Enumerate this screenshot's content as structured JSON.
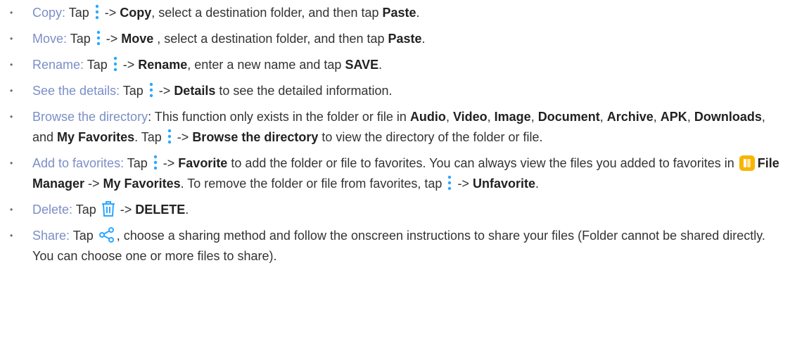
{
  "colors": {
    "label": "#7b8fc7",
    "icon": "#2aa7ff",
    "app_icon": "#f7b500"
  },
  "icons": {
    "menu": "vertical-dots-icon",
    "delete": "trash-icon",
    "share": "share-icon",
    "app": "file-manager-app-icon"
  },
  "items": [
    {
      "label": "Copy:",
      "t1": " Tap ",
      "t2": " -> ",
      "b1": "Copy",
      "t3": ", select a destination folder, and then tap ",
      "b2": "Paste",
      "t4": "."
    },
    {
      "label": "Move:",
      "t1": " Tap ",
      "t2": " -> ",
      "b1": "Move",
      "t3": " , select a destination folder, and then tap ",
      "b2": "Paste",
      "t4": "."
    },
    {
      "label": "Rename:",
      "t1": " Tap ",
      "t2": " -> ",
      "b1": "Rename",
      "t3": ", enter a new name and tap ",
      "b2": "SAVE",
      "t4": "."
    },
    {
      "label": "See the details:",
      "t1": " Tap ",
      "t2": " -> ",
      "b1": "Details",
      "t3": " to see the detailed information."
    },
    {
      "label": "Browse the directory",
      "t1": ": This function only exists in the folder or file in ",
      "b1": "Audio",
      "s1": ", ",
      "b2": "Video",
      "s2": ", ",
      "b3": "Image",
      "s3": ", ",
      "b4": "Document",
      "s4": ", ",
      "b5": "Archive",
      "s5": ", ",
      "b6": "APK",
      "s6": ", ",
      "b7": "Downloads",
      "s7": ", and ",
      "b8": "My Favorites",
      "s8": ". Tap ",
      "s9": " -> ",
      "b9": "Browse the directory",
      "s10": " to view the directory of the folder or file."
    },
    {
      "label": "Add to favorites:",
      "t1": " Tap ",
      "t2": " -> ",
      "b1": "Favorite",
      "t3": " to add the folder or file to favorites. You can always view the files you added to favorites in ",
      "b2": "File Manager",
      "t4": " -> ",
      "b3": "My Favorites",
      "t5": ". To remove the folder or file from favorites, tap ",
      "t6": " -> ",
      "b4": "Unfavorite",
      "t7": "."
    },
    {
      "label": "Delete:",
      "t1": " Tap ",
      "t2": " -> ",
      "b1": "DELETE",
      "t3": "."
    },
    {
      "label": "Share:",
      "t1": " Tap ",
      "t2": ", choose a sharing method and follow the onscreen instructions to share your files (Folder cannot be shared directly. You can choose one or more files to share)."
    }
  ]
}
